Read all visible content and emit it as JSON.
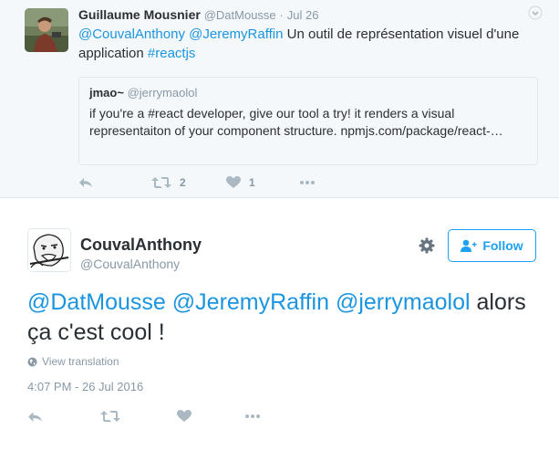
{
  "parent_tweet": {
    "author_name": "Guillaume Mousnier",
    "author_handle": "@DatMousse",
    "separator": "·",
    "date": "Jul 26",
    "text_parts": [
      "@CouvalAnthony",
      " ",
      "@JeremyRaffin",
      " Un outil de représentation visuel d'une application ",
      "#reactjs"
    ],
    "quoted": {
      "author_name": "jmao~",
      "author_handle": "@jerrymaolol",
      "text": "if you're a #react developer, give our tool a try! it renders a visual representaiton of your component structure. npmjs.com/package/react-…"
    },
    "actions": {
      "retweet_count": "2",
      "like_count": "1"
    },
    "icons": [
      "chevron-down-icon",
      "reply-icon",
      "retweet-icon",
      "heart-icon",
      "more-icon"
    ]
  },
  "main_tweet": {
    "author_name": "CouvalAnthony",
    "author_handle": "@CouvalAnthony",
    "follow_label": "Follow",
    "text_parts": [
      "@DatMousse",
      " ",
      "@JeremyRaffin",
      " ",
      "@jerrymaolol",
      " alors ça c'est cool !"
    ],
    "translate_label": "View translation",
    "timestamp": "4:07 PM - 26 Jul 2016",
    "icons": [
      "gear-icon",
      "follow-user-icon",
      "globe-icon",
      "reply-icon",
      "retweet-icon",
      "heart-icon",
      "more-icon"
    ]
  },
  "colors": {
    "link": "#1b95e0",
    "follow_accent": "#1da1f2",
    "muted": "#8899a6",
    "icon": "#aab8c2",
    "parent_bg": "#f5f8fa"
  }
}
